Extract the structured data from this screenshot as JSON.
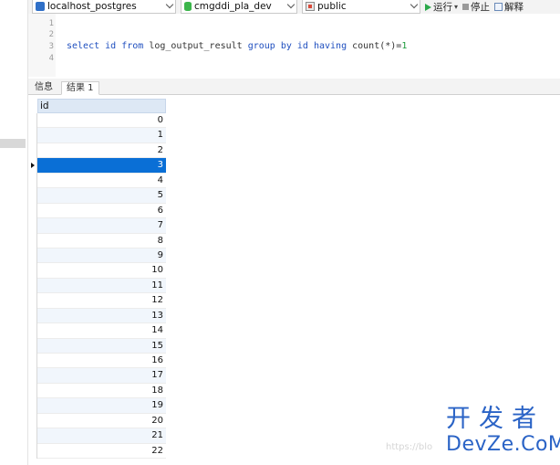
{
  "toolbar": {
    "connection": "localhost_postgres",
    "database": "cmgddi_pla_dev",
    "schema": "public",
    "run_label": "运行",
    "stop_label": "停止",
    "explain_label": "解释"
  },
  "editor": {
    "line_numbers": [
      "1",
      "2",
      "3",
      "4"
    ],
    "sql": {
      "t1": "select id ",
      "t2": "from",
      "t3": " log_output_result ",
      "t4": "group by",
      "t5": " id ",
      "t6": "having",
      "t7": " count(*)=",
      "t8": "1"
    }
  },
  "tabs": [
    {
      "label": "信息"
    },
    {
      "label": "结果 1"
    }
  ],
  "result": {
    "column": "id",
    "rows": [
      "0",
      "1",
      "2",
      "3",
      "4",
      "5",
      "6",
      "7",
      "8",
      "9",
      "10",
      "11",
      "12",
      "13",
      "14",
      "15",
      "16",
      "17",
      "18",
      "19",
      "20",
      "21",
      "22"
    ],
    "selected_row": "3"
  },
  "watermark": {
    "url": "https://blo",
    "cn": "开发者",
    "en": "DevZe.CoM"
  },
  "colors": {
    "selection": "#0a6fd6",
    "header": "#dde8f5",
    "keyword": "#1f4fbf",
    "watermark": "#2a63c6"
  }
}
